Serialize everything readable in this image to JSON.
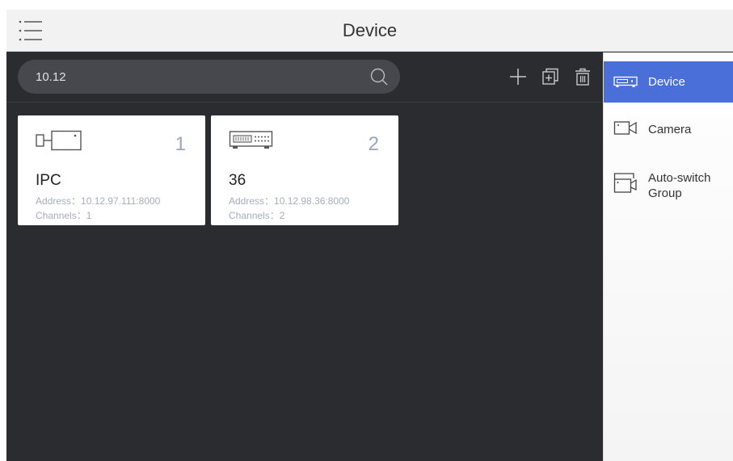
{
  "header": {
    "title": "Device"
  },
  "search": {
    "value": "10.12"
  },
  "cards": [
    {
      "index": "1",
      "name": "IPC",
      "address": "Address：10.12.97.111:8000",
      "channels": "Channels：1"
    },
    {
      "index": "2",
      "name": "36",
      "address": "Address：10.12.98.36:8000",
      "channels": "Channels：2"
    }
  ],
  "sidebar": {
    "items": [
      {
        "label": "Device",
        "icon": "device-icon",
        "active": true
      },
      {
        "label": "Camera",
        "icon": "camera-icon",
        "active": false
      },
      {
        "label": "Auto-switch Group",
        "icon": "auto-switch-group-icon",
        "active": false
      }
    ]
  },
  "colors": {
    "accent": "#4a6fd8",
    "background": "#2b2c30",
    "header": "#f2f2f2"
  }
}
